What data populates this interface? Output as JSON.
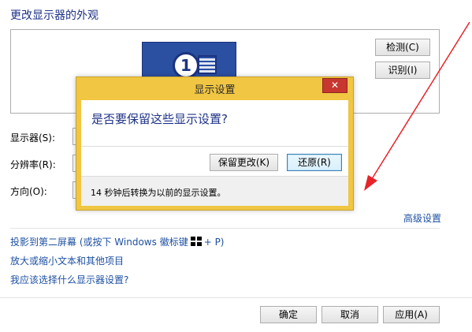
{
  "page": {
    "title": "更改显示器的外观",
    "detect_button": "检测(C)",
    "identify_button": "识别(I)",
    "monitor_number": "1",
    "display_label": "显示器(S):",
    "resolution_label": "分辨率(R):",
    "orientation_label": "方向(O):",
    "advanced_link": "高级设置",
    "project_link_before": "投影到第二屏幕 (或按下 Windows 徽标键",
    "project_link_after": "+ P)",
    "zoom_link": "放大或缩小文本和其他项目",
    "which_settings_link": "我应该选择什么显示器设置?",
    "ok_button": "确定",
    "cancel_button": "取消",
    "apply_button": "应用(A)"
  },
  "dialog": {
    "title": "显示设置",
    "close_glyph": "✕",
    "question": "是否要保留这些显示设置?",
    "keep_button": "保留更改(K)",
    "revert_button": "还原(R)",
    "countdown": "14 秒钟后转换为以前的显示设置。"
  },
  "colors": {
    "dialog_frame": "#f0c642",
    "close_button": "#c7372f",
    "heading_blue": "#1e3287",
    "link_blue": "#1e50a2",
    "annotation_arrow": "#e8232a"
  },
  "icons": {
    "monitor": "monitor-number-icon",
    "windows_logo": "windows-logo-icon",
    "close": "close-icon",
    "annotation": "red-arrow-annotation"
  }
}
